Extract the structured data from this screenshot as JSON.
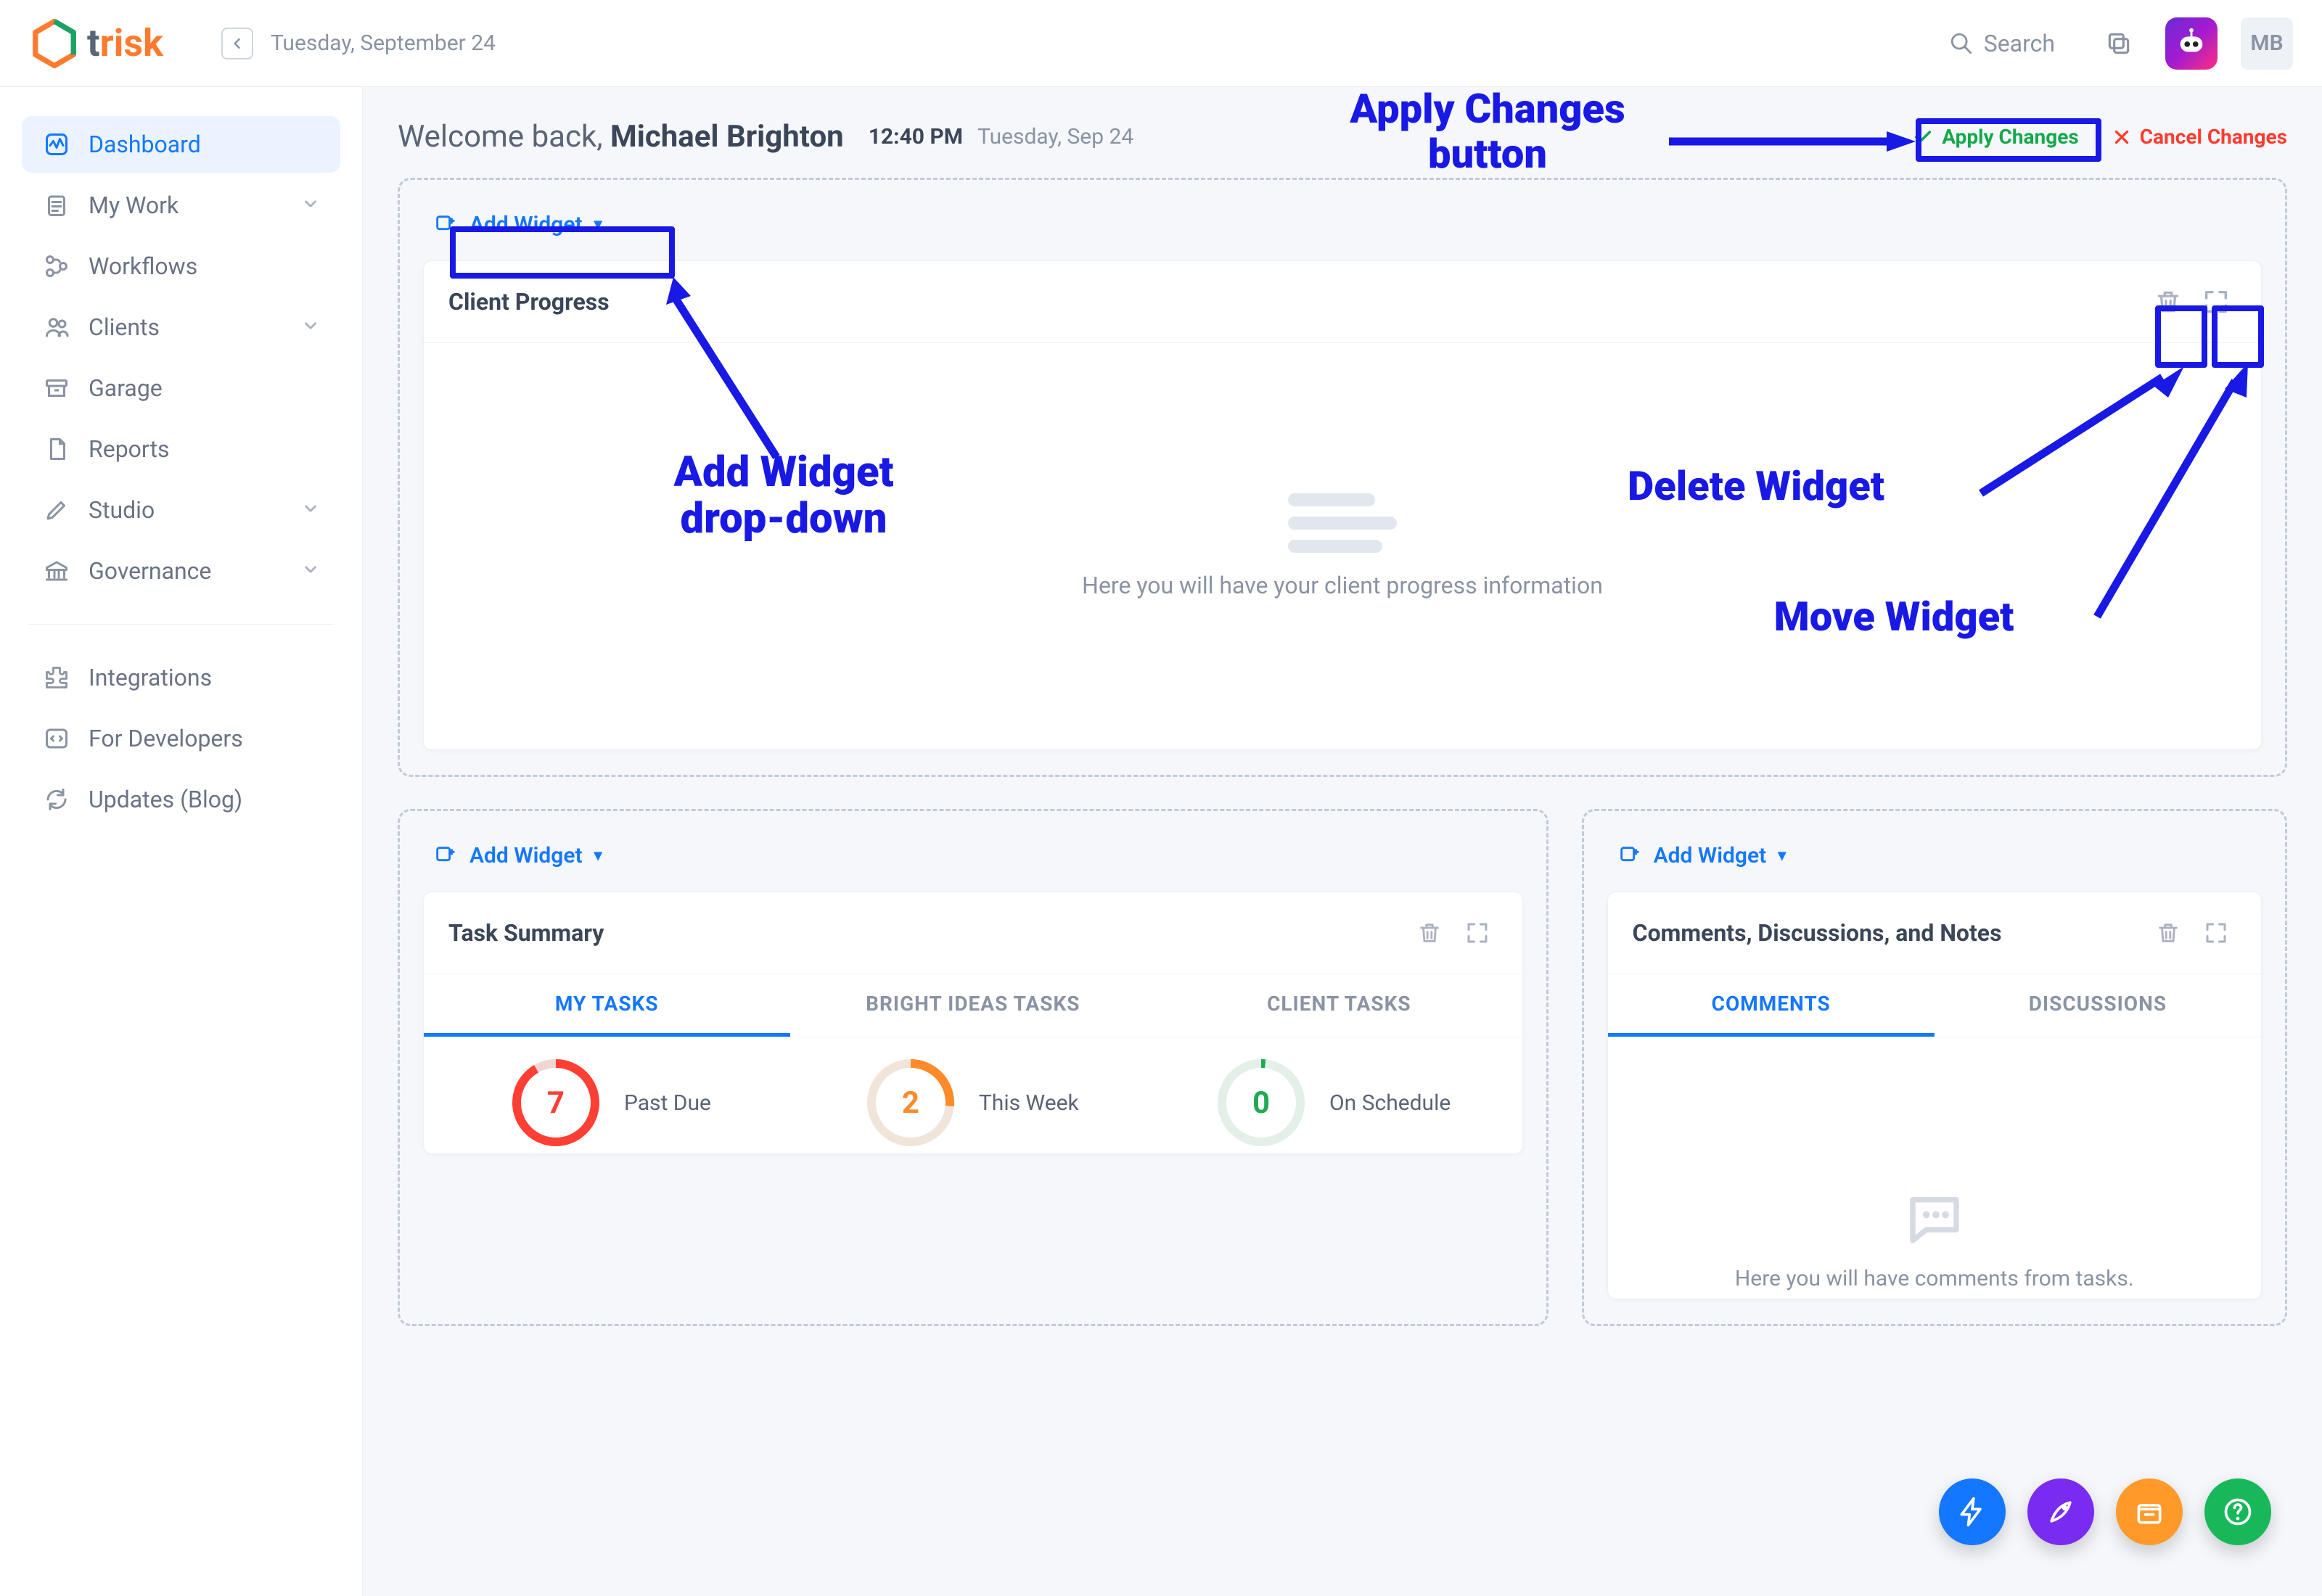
{
  "brand": {
    "name_pre": "t",
    "name_post": "risk"
  },
  "header": {
    "date": "Tuesday, September 24",
    "search_placeholder": "Search",
    "avatar_initials": "MB"
  },
  "sidebar": {
    "items": [
      {
        "label": "Dashboard",
        "icon": "pulse",
        "active": true
      },
      {
        "label": "My Work",
        "icon": "clipboard",
        "expandable": true
      },
      {
        "label": "Workflows",
        "icon": "branch"
      },
      {
        "label": "Clients",
        "icon": "people",
        "expandable": true
      },
      {
        "label": "Garage",
        "icon": "archive"
      },
      {
        "label": "Reports",
        "icon": "doc"
      },
      {
        "label": "Studio",
        "icon": "pencil",
        "expandable": true
      },
      {
        "label": "Governance",
        "icon": "bank",
        "expandable": true
      }
    ],
    "bottom_items": [
      {
        "label": "Integrations",
        "icon": "puzzle"
      },
      {
        "label": "For Developers",
        "icon": "code"
      },
      {
        "label": "Updates (Blog)",
        "icon": "refresh"
      }
    ]
  },
  "welcome": {
    "prefix": "Welcome back, ",
    "name": "Michael Brighton",
    "time": "12:40 PM",
    "date_small": "Tuesday, Sep 24",
    "apply_label": "Apply Changes",
    "cancel_label": "Cancel Changes"
  },
  "add_widget_label": "Add Widget",
  "widgets": {
    "client_progress": {
      "title": "Client Progress",
      "empty_text": "Here you will have your client progress information"
    },
    "task_summary": {
      "title": "Task Summary",
      "tabs": [
        "MY TASKS",
        "BRIGHT IDEAS TASKS",
        "CLIENT TASKS"
      ],
      "metrics": [
        {
          "value": "7",
          "label": "Past Due"
        },
        {
          "value": "2",
          "label": "This Week"
        },
        {
          "value": "0",
          "label": "On Schedule"
        }
      ]
    },
    "comments": {
      "title": "Comments, Discussions, and Notes",
      "tabs": [
        "COMMENTS",
        "DISCUSSIONS"
      ],
      "empty_text": "Here you will have comments from tasks."
    }
  },
  "annotations": {
    "apply": "Apply Changes\nbutton",
    "addw": "Add Widget\ndrop-down",
    "delete": "Delete Widget",
    "move": "Move Widget"
  }
}
